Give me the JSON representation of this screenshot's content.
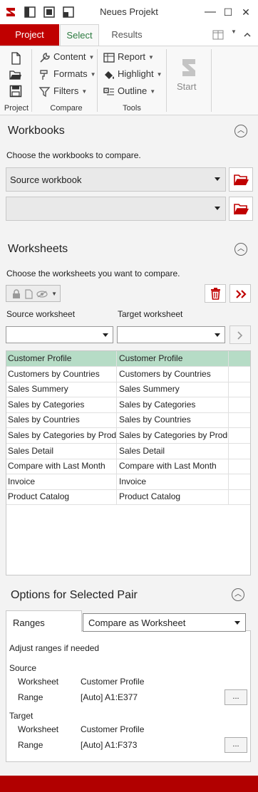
{
  "window": {
    "title": "Neues Projekt",
    "minimize": "—",
    "maximize": "☐",
    "close": "✕"
  },
  "tabs": [
    {
      "label": "Project"
    },
    {
      "label": "Select"
    },
    {
      "label": "Results"
    }
  ],
  "ribbon": {
    "project_group": "Project",
    "compare_group": "Compare",
    "tools_group": "Tools",
    "content": "Content",
    "formats": "Formats",
    "filters": "Filters",
    "report": "Report",
    "highlight": "Highlight",
    "outline": "Outline",
    "start": "Start"
  },
  "workbooks": {
    "title": "Workbooks",
    "hint": "Choose the workbooks to compare.",
    "source_value": "Source workbook",
    "target_value": ""
  },
  "worksheets": {
    "title": "Worksheets",
    "hint": "Choose the worksheets you want to compare.",
    "source_label": "Source worksheet",
    "target_label": "Target worksheet",
    "pairs": [
      {
        "source": "Customer Profile",
        "target": "Customer Profile"
      },
      {
        "source": "Customers by Countries",
        "target": "Customers by Countries"
      },
      {
        "source": "Sales Summery",
        "target": "Sales Summery"
      },
      {
        "source": "Sales by Categories",
        "target": "Sales by Categories"
      },
      {
        "source": "Sales by Countries",
        "target": "Sales by Countries"
      },
      {
        "source": "Sales by Categories by Products",
        "target": "Sales by Categories by Products"
      },
      {
        "source": "Sales Detail",
        "target": "Sales Detail"
      },
      {
        "source": "Compare with Last Month",
        "target": "Compare with Last Month"
      },
      {
        "source": "Invoice",
        "target": "Invoice"
      },
      {
        "source": "Product Catalog",
        "target": "Product Catalog"
      }
    ]
  },
  "options": {
    "title": "Options for Selected Pair",
    "ranges_tab": "Ranges",
    "mode": "Compare as Worksheet",
    "hint": "Adjust ranges if needed",
    "source_heading": "Source",
    "target_heading": "Target",
    "worksheet_label": "Worksheet",
    "range_label": "Range",
    "source_worksheet": "Customer Profile",
    "source_range": "[Auto] A1:E377",
    "target_worksheet": "Customer Profile",
    "target_range": "[Auto] A1:F373",
    "browse": "..."
  },
  "colors": {
    "accent": "#c00000",
    "selection": "#b6dcc6",
    "select_tab": "#2b7a3f"
  }
}
